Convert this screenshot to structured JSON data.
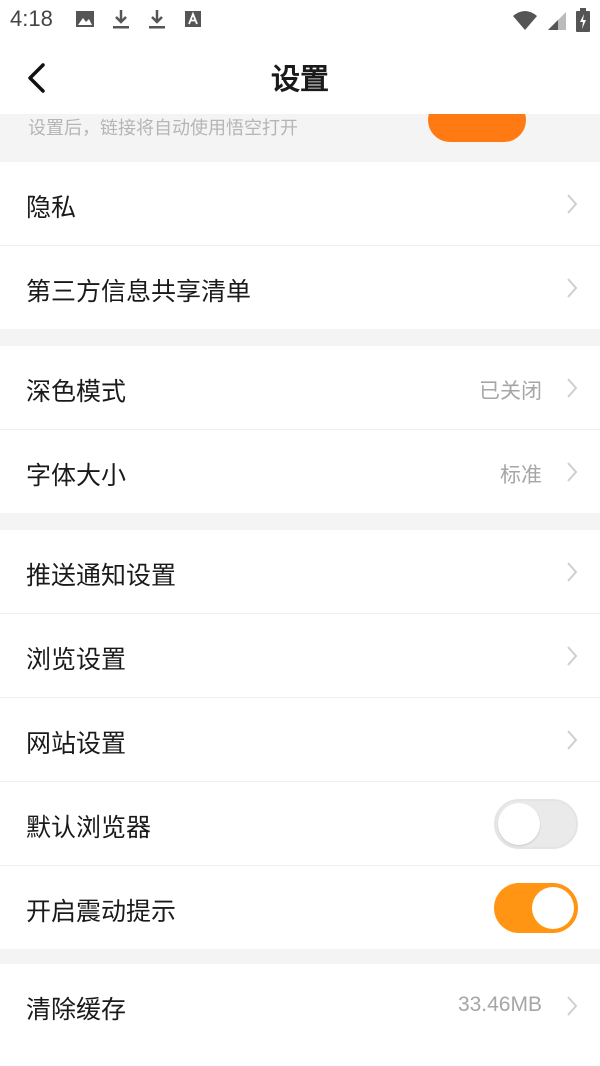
{
  "status_bar": {
    "time": "4:18"
  },
  "header": {
    "title": "设置"
  },
  "partial_row": {
    "text": "设置后，链接将自动使用悟空打开"
  },
  "groups": [
    {
      "items": [
        {
          "label": "隐私"
        },
        {
          "label": "第三方信息共享清单"
        }
      ]
    },
    {
      "items": [
        {
          "label": "深色模式",
          "value": "已关闭"
        },
        {
          "label": "字体大小",
          "value": "标准"
        }
      ]
    },
    {
      "items": [
        {
          "label": "推送通知设置"
        },
        {
          "label": "浏览设置"
        },
        {
          "label": "网站设置"
        },
        {
          "label": "默认浏览器",
          "toggle": false
        },
        {
          "label": "开启震动提示",
          "toggle": true
        }
      ]
    },
    {
      "items": [
        {
          "label": "清除缓存",
          "value": "33.46MB"
        }
      ]
    }
  ],
  "colors": {
    "accent": "#ff9512",
    "toggle_off": "#eaeaea",
    "chevron": "#cfcfcf"
  }
}
